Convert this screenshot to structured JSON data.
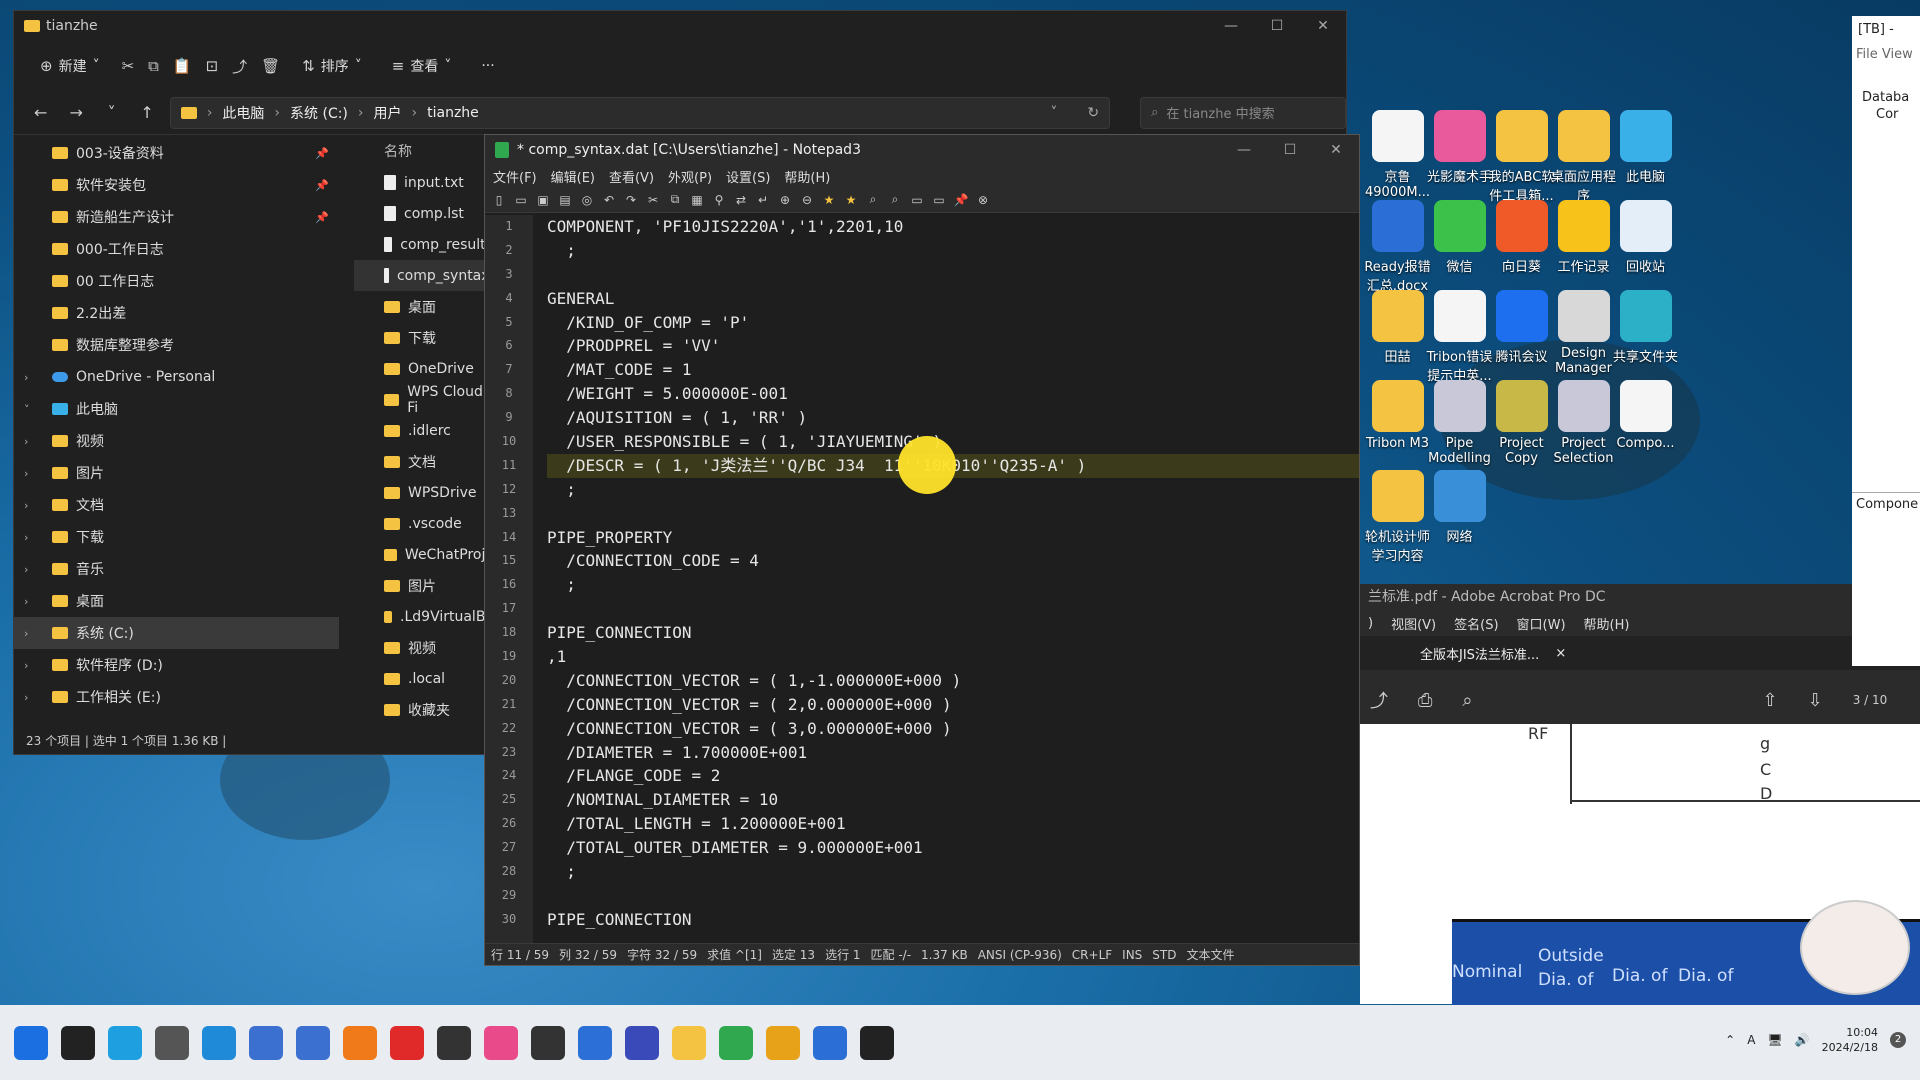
{
  "explorer": {
    "title": "tianzhe",
    "toolbar": {
      "new": "新建",
      "sort": "排序",
      "view": "查看",
      "more": "···"
    },
    "breadcrumb": [
      "此电脑",
      "系统 (C:)",
      "用户",
      "tianzhe"
    ],
    "search_placeholder": "在 tianzhe 中搜索",
    "sidebar": [
      {
        "label": "003-设备资料",
        "pinned": true
      },
      {
        "label": "软件安装包",
        "pinned": true
      },
      {
        "label": "新造船生产设计",
        "pinned": true
      },
      {
        "label": "000-工作日志"
      },
      {
        "label": "00 工作日志"
      },
      {
        "label": "2.2出差"
      },
      {
        "label": "数据库整理参考"
      },
      {
        "label": "OneDrive - Personal",
        "kind": "cloud"
      },
      {
        "label": "此电脑",
        "kind": "pc"
      },
      {
        "label": "视频"
      },
      {
        "label": "图片"
      },
      {
        "label": "文档"
      },
      {
        "label": "下载"
      },
      {
        "label": "音乐"
      },
      {
        "label": "桌面"
      },
      {
        "label": "系统 (C:)",
        "selected": true
      },
      {
        "label": "软件程序 (D:)"
      },
      {
        "label": "工作相关 (E:)"
      }
    ],
    "file_header": "名称",
    "files": [
      {
        "name": "input.txt",
        "type": "doc"
      },
      {
        "name": "comp.lst",
        "type": "doc"
      },
      {
        "name": "comp_result.l",
        "type": "doc"
      },
      {
        "name": "comp_syntax.",
        "type": "doc",
        "selected": true
      },
      {
        "name": "桌面",
        "type": "folder"
      },
      {
        "name": "下载",
        "type": "folder"
      },
      {
        "name": "OneDrive",
        "type": "folder"
      },
      {
        "name": "WPS Cloud Fi",
        "type": "folder"
      },
      {
        "name": ".idlerc",
        "type": "folder"
      },
      {
        "name": "文档",
        "type": "folder"
      },
      {
        "name": "WPSDrive",
        "type": "folder"
      },
      {
        "name": ".vscode",
        "type": "folder"
      },
      {
        "name": "WeChatProje",
        "type": "folder"
      },
      {
        "name": "图片",
        "type": "folder"
      },
      {
        "name": ".Ld9VirtualBo",
        "type": "folder"
      },
      {
        "name": "视频",
        "type": "folder"
      },
      {
        "name": ".local",
        "type": "folder"
      },
      {
        "name": "收藏夹",
        "type": "folder"
      }
    ],
    "status": "23 个项目  |  选中 1 个项目  1.36 KB  |"
  },
  "notepad": {
    "title": "* comp_syntax.dat [C:\\Users\\tianzhe] - Notepad3",
    "menu": [
      "文件(F)",
      "编辑(E)",
      "查看(V)",
      "外观(P)",
      "设置(S)",
      "帮助(H)"
    ],
    "lines": [
      "COMPONENT, 'PF10JIS2220A','1',2201,10",
      "  ;",
      "",
      "GENERAL",
      "  /KIND_OF_COMP = 'P'",
      "  /PRODPREL = 'VV'",
      "  /MAT_CODE = 1",
      "  /WEIGHT = 5.000000E-001",
      "  /AQUISITION = ( 1, 'RR' )",
      "  /USER_RESPONSIBLE = ( 1, 'JIAYUEMING' )",
      "  /DESCR = ( 1, 'J类法兰''Q/BC J34  11''10K010''Q235-A' )",
      "  ;",
      "",
      "PIPE_PROPERTY",
      "  /CONNECTION_CODE = 4",
      "  ;",
      "",
      "PIPE_CONNECTION",
      ",1",
      "  /CONNECTION_VECTOR = ( 1,-1.000000E+000 )",
      "  /CONNECTION_VECTOR = ( 2,0.000000E+000 )",
      "  /CONNECTION_VECTOR = ( 3,0.000000E+000 )",
      "  /DIAMETER = 1.700000E+001",
      "  /FLANGE_CODE = 2",
      "  /NOMINAL_DIAMETER = 10",
      "  /TOTAL_LENGTH = 1.200000E+001",
      "  /TOTAL_OUTER_DIAMETER = 9.000000E+001",
      "  ;",
      "",
      "PIPE_CONNECTION"
    ],
    "status": [
      "行  11 / 59",
      "列  32 / 59",
      "字符  32 / 59",
      "求值  ^[1]",
      "选定  13",
      "选行  1",
      "匹配  -/-",
      "1.37 KB",
      "ANSI (CP-936)",
      "CR+LF",
      "INS",
      "STD",
      "文本文件"
    ]
  },
  "desktop_icons": [
    {
      "label": "京鲁49000M...",
      "color": "#f5f5f5"
    },
    {
      "label": "光影魔术手",
      "color": "#e85a9c"
    },
    {
      "label": "我的ABC软件工具箱...",
      "color": "#f5c342"
    },
    {
      "label": "桌面应用程序",
      "color": "#f5c342"
    },
    {
      "label": "此电脑",
      "color": "#3ab0e8"
    },
    {
      "label": "Ready报错汇总.docx",
      "color": "#2b6fd6"
    },
    {
      "label": "微信",
      "color": "#3cc24a"
    },
    {
      "label": "向日葵",
      "color": "#f05a28"
    },
    {
      "label": "工作记录",
      "color": "#f7c21a"
    },
    {
      "label": "回收站",
      "color": "#e4eef8"
    },
    {
      "label": "田喆",
      "color": "#f5c342"
    },
    {
      "label": "Tribon错误提示中英...",
      "color": "#f5f5f5"
    },
    {
      "label": "腾讯会议",
      "color": "#1e6ff0"
    },
    {
      "label": "Design Manager",
      "color": "#d8d8d8"
    },
    {
      "label": "共享文件夹",
      "color": "#2bb0c8"
    },
    {
      "label": "Tribon M3",
      "color": "#f5c342"
    },
    {
      "label": "Pipe Modelling",
      "color": "#c8c8d8"
    },
    {
      "label": "Project Copy",
      "color": "#c8b848"
    },
    {
      "label": "Project Selection",
      "color": "#c8c8d8"
    },
    {
      "label": "Compo...",
      "color": "#f5f5f5"
    },
    {
      "label": "轮机设计师学习内容",
      "color": "#f5c342"
    },
    {
      "label": "网络",
      "color": "#3a90d8"
    }
  ],
  "acrobat": {
    "title": "兰标准.pdf - Adobe Acrobat Pro DC",
    "menu": [
      ")",
      "视图(V)",
      "签名(S)",
      "窗口(W)",
      "帮助(H)"
    ],
    "tab": "全版本JIS法兰标准...",
    "page": "3",
    "pages": "/ 10",
    "drawing_labels": [
      "RF",
      "g",
      "C",
      "D"
    ],
    "table_headers": [
      "Nominal",
      "Outside",
      "Dia. of",
      "Dia. of",
      "Dia. of"
    ]
  },
  "tb_panel": {
    "title": "[TB] -",
    "menu": [
      "File",
      "View"
    ],
    "tree": [
      "Databa",
      "Cor"
    ],
    "footer": "Compone"
  },
  "taskbar": {
    "icons": [
      "#1b6fe0",
      "#222",
      "#1ea0e0",
      "#555",
      "#1e8ad8",
      "#3b6fd0",
      "#3b6fd0",
      "#f07a1a",
      "#e02a2a",
      "#333",
      "#e84a8a",
      "#333",
      "#2c6fd6",
      "#3a4ab8",
      "#f5c342",
      "#2fa84f",
      "#e8a21a",
      "#2b6fd6",
      "#222"
    ],
    "time": "10:04",
    "date": "2024/2/18",
    "notif_count": "2",
    "ime": "A"
  }
}
